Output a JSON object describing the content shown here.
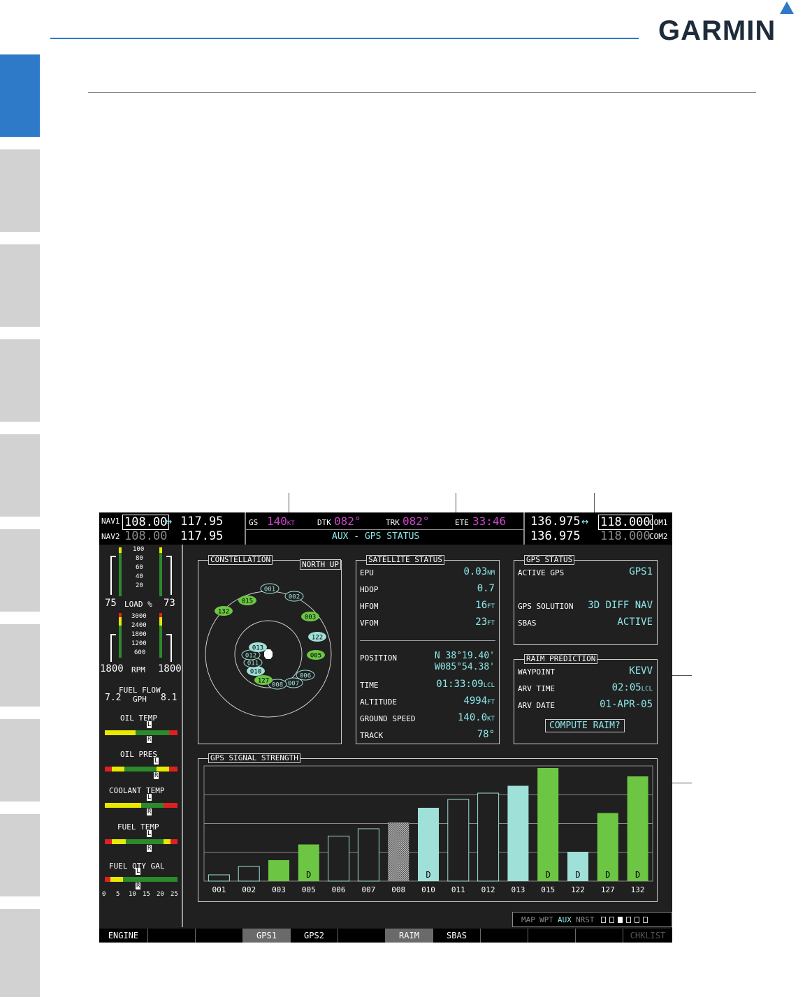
{
  "brand": {
    "logo_text": "GARMIN"
  },
  "nav": {
    "nav1_label": "NAV1",
    "nav1_active": "108.00",
    "nav1_standby": "117.95",
    "nav2_label": "NAV2",
    "nav2_active": "108.00",
    "nav2_standby": "117.95",
    "swap_symbol": "↔"
  },
  "nav_data_bar": {
    "gs_label": "GS",
    "gs_value": "140",
    "gs_unit": "KT",
    "dtk_label": "DTK",
    "dtk_value": "082°",
    "trk_label": "TRK",
    "trk_value": "082°",
    "ete_label": "ETE",
    "ete_value": "33:46",
    "page_title": "AUX - GPS STATUS"
  },
  "com": {
    "com1_standby": "136.975",
    "com1_active": "118.000",
    "com1_label": "COM1",
    "com2_standby": "136.975",
    "com2_active": "118.000",
    "com2_label": "COM2"
  },
  "eis": {
    "load_ticks": [
      "100",
      "80",
      "60",
      "40",
      "20"
    ],
    "load_left": "75",
    "load_label": "LOAD %",
    "load_right": "73",
    "rpm_ticks": [
      "3000",
      "2400",
      "1800",
      "1200",
      "600"
    ],
    "rpm_left": "1800",
    "rpm_label": "RPM",
    "rpm_right": "1800",
    "fuel_flow_label": "FUEL FLOW",
    "fuel_flow_left": "7.2",
    "fuel_flow_unit": "GPH",
    "fuel_flow_right": "8.1",
    "oil_temp_label": "OIL TEMP",
    "oil_pres_label": "OIL PRES",
    "coolant_temp_label": "COOLANT TEMP",
    "fuel_temp_label": "FUEL TEMP",
    "fuel_qty_label": "FUEL QTY GAL",
    "fuel_qty_ticks": [
      "0",
      "5",
      "10",
      "15",
      "20",
      "25"
    ],
    "pointer_left": "L",
    "pointer_right": "R"
  },
  "constellation": {
    "title": "CONSTELLATION",
    "orientation_button": "NORTH UP",
    "satellites": [
      {
        "id": "001",
        "state": "outline"
      },
      {
        "id": "002",
        "state": "outline"
      },
      {
        "id": "003",
        "state": "green"
      },
      {
        "id": "005",
        "state": "green"
      },
      {
        "id": "006",
        "state": "outline"
      },
      {
        "id": "007",
        "state": "outline"
      },
      {
        "id": "008",
        "state": "outline"
      },
      {
        "id": "010",
        "state": "cyan"
      },
      {
        "id": "011",
        "state": "outline"
      },
      {
        "id": "012",
        "state": "outline"
      },
      {
        "id": "013",
        "state": "cyan"
      },
      {
        "id": "015",
        "state": "green"
      },
      {
        "id": "122",
        "state": "cyan"
      },
      {
        "id": "127",
        "state": "green"
      },
      {
        "id": "132",
        "state": "green"
      }
    ]
  },
  "satellite_status": {
    "title": "SATELLITE STATUS",
    "epu_label": "EPU",
    "epu_value": "0.03",
    "epu_unit": "NM",
    "hdop_label": "HDOP",
    "hdop_value": "0.7",
    "hfom_label": "HFOM",
    "hfom_value": "16",
    "hfom_unit": "FT",
    "vfom_label": "VFOM",
    "vfom_value": "23",
    "vfom_unit": "FT",
    "position_label": "POSITION",
    "lat": "N 38°19.40'",
    "lon": "W085°54.38'",
    "time_label": "TIME",
    "time_value": "01:33:09",
    "time_unit": "LCL",
    "altitude_label": "ALTITUDE",
    "altitude_value": "4994",
    "altitude_unit": "FT",
    "ground_speed_label": "GROUND SPEED",
    "ground_speed_value": "140.0",
    "ground_speed_unit": "KT",
    "track_label": "TRACK",
    "track_value": "78°"
  },
  "gps_status": {
    "title": "GPS STATUS",
    "active_gps_label": "ACTIVE GPS",
    "active_gps_value": "GPS1",
    "solution_label": "GPS SOLUTION",
    "solution_value": "3D DIFF NAV",
    "sbas_label": "SBAS",
    "sbas_value": "ACTIVE"
  },
  "raim": {
    "title": "RAIM PREDICTION",
    "waypoint_label": "WAYPOINT",
    "waypoint_value": "KEVV",
    "arv_time_label": "ARV TIME",
    "arv_time_value": "02:05",
    "arv_time_unit": "LCL",
    "arv_date_label": "ARV DATE",
    "arv_date_value": "01-APR-05",
    "compute_button": "COMPUTE RAIM?"
  },
  "signal_strength": {
    "title": "GPS SIGNAL STRENGTH",
    "diff_marker": "D"
  },
  "chart_data": {
    "type": "bar",
    "title": "GPS SIGNAL STRENGTH",
    "categories": [
      "001",
      "002",
      "003",
      "005",
      "006",
      "007",
      "008",
      "010",
      "011",
      "012",
      "013",
      "015",
      "122",
      "127",
      "132"
    ],
    "values": [
      6,
      14,
      20,
      35,
      43,
      50,
      56,
      70,
      78,
      84,
      91,
      108,
      28,
      65,
      100
    ],
    "states": [
      "outline",
      "outline",
      "green",
      "green",
      "outline",
      "outline",
      "hatched",
      "cyan",
      "outline",
      "outline",
      "cyan",
      "green",
      "cyan",
      "green",
      "green"
    ],
    "diff": [
      false,
      false,
      false,
      true,
      false,
      false,
      false,
      true,
      false,
      false,
      false,
      true,
      true,
      true,
      true
    ],
    "ylim": [
      0,
      110
    ],
    "grid": true
  },
  "page_group": {
    "labels": [
      "MAP",
      "WPT",
      "AUX",
      "NRST"
    ],
    "active": "AUX"
  },
  "softkeys": [
    "ENGINE",
    "",
    "",
    "GPS1",
    "GPS2",
    "",
    "RAIM",
    "SBAS",
    "",
    "",
    "",
    "CHKLIST"
  ]
}
